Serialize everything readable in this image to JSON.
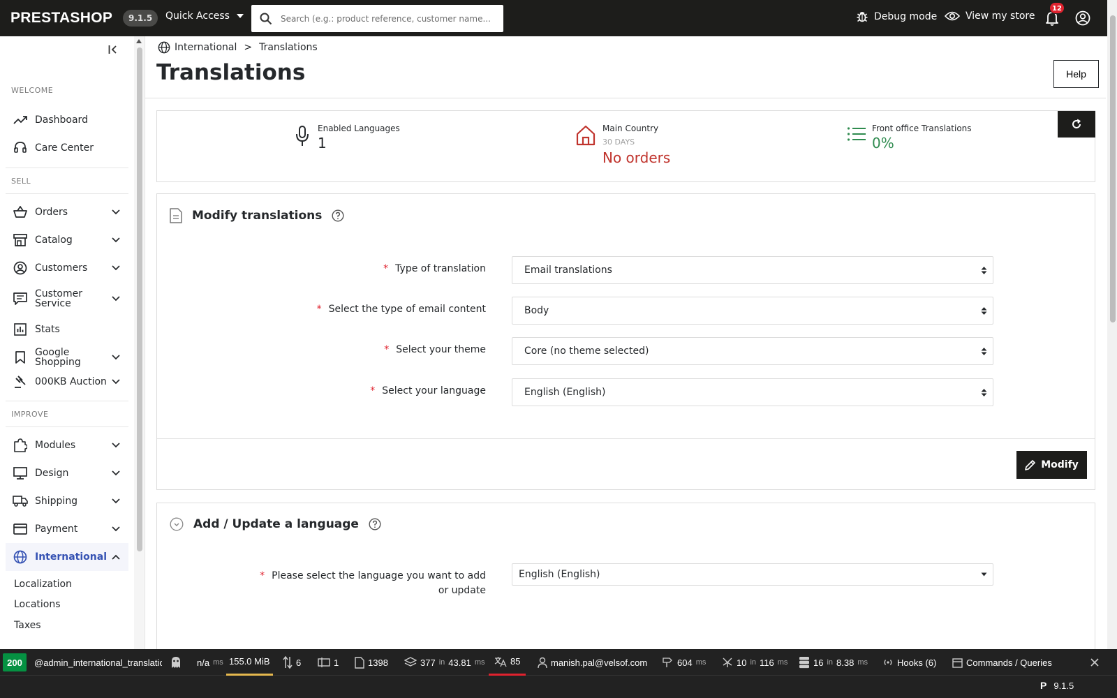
{
  "topbar": {
    "logo": "PRESTASHOP",
    "version": "9.1.5",
    "quick_access": "Quick Access",
    "search_placeholder": "Search (e.g.: product reference, customer name...)",
    "debug_mode": "Debug mode",
    "view_store": "View my store",
    "notifications_count": "12"
  },
  "sidebar": {
    "sections": {
      "welcome": "WELCOME",
      "sell": "SELL",
      "improve": "IMPROVE"
    },
    "items": {
      "dashboard": "Dashboard",
      "care_center": "Care Center",
      "orders": "Orders",
      "catalog": "Catalog",
      "customers": "Customers",
      "customer_service": "Customer Service",
      "stats": "Stats",
      "google_shopping": "Google Shopping",
      "auction": "000KB Auction",
      "modules": "Modules",
      "design": "Design",
      "shipping": "Shipping",
      "payment": "Payment",
      "international": "International"
    },
    "subitems": {
      "localization": "Localization",
      "locations": "Locations",
      "taxes": "Taxes"
    }
  },
  "header": {
    "breadcrumb_parent": "International",
    "breadcrumb_sep": ">",
    "breadcrumb_current": "Translations",
    "title": "Translations",
    "help": "Help"
  },
  "kpis": {
    "enabled_languages_label": "Enabled Languages",
    "enabled_languages_value": "1",
    "main_country_label": "Main Country",
    "main_country_sub": "30 DAYS",
    "main_country_value": "No orders",
    "front_office_label": "Front office Translations",
    "front_office_value": "0%",
    "colors": {
      "country": "#c0332c",
      "front_office": "#2f8b4f"
    }
  },
  "modify_card": {
    "title": "Modify translations",
    "fields": {
      "type_label": "Type of translation",
      "type_value": "Email translations",
      "email_content_label": "Select the type of email content",
      "email_content_value": "Body",
      "theme_label": "Select your theme",
      "theme_value": "Core (no theme selected)",
      "language_label": "Select your language",
      "language_value": "English (English)"
    },
    "modify_button": "Modify"
  },
  "add_card": {
    "title": "Add / Update a language",
    "language_label": "Please select the language you want to add or update",
    "language_value": "English (English)"
  },
  "debugbar": {
    "status": "200",
    "route": "@admin_international_translatio",
    "time_value": "n/a",
    "time_unit": "ms",
    "memory": "155.0 MiB",
    "requests": "6",
    "forms": "1",
    "translations_files": "1398",
    "cache_count": "377",
    "cache_in": "in",
    "cache_time": "43.81",
    "cache_unit": "ms",
    "translation_missing": "85",
    "user": "manish.pal@velsof.com",
    "perf_time": "604",
    "perf_unit": "ms",
    "events_count": "10",
    "events_in": "in",
    "events_time": "116",
    "events_unit": "ms",
    "db_count": "16",
    "db_in": "in",
    "db_time": "8.38",
    "db_unit": "ms",
    "hooks": "Hooks (6)",
    "commands": "Commands / Queries",
    "footer_version": "9.1.5",
    "colors": {
      "status": "#059142",
      "memory_underline": "#e5b84e",
      "missing_underline": "#e0222e"
    }
  }
}
